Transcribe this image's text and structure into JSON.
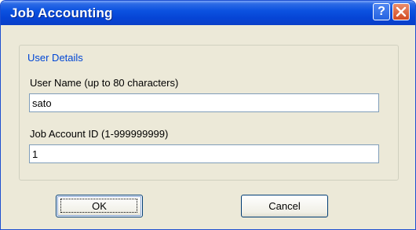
{
  "dialog": {
    "title": "Job Accounting",
    "help_label": "?",
    "group_title": "User Details",
    "user_name_label": "User Name (up to 80 characters)",
    "user_name_value": "sato",
    "job_account_label": "Job Account ID (1-999999999)",
    "job_account_value": "1",
    "ok_label": "OK",
    "cancel_label": "Cancel"
  },
  "icons": {
    "help": "help-icon",
    "close": "close-icon"
  },
  "colors": {
    "title_bar": "#0a52e0",
    "group_title": "#0046d5",
    "dialog_bg": "#ece9d8",
    "close_button": "#d24a22"
  }
}
